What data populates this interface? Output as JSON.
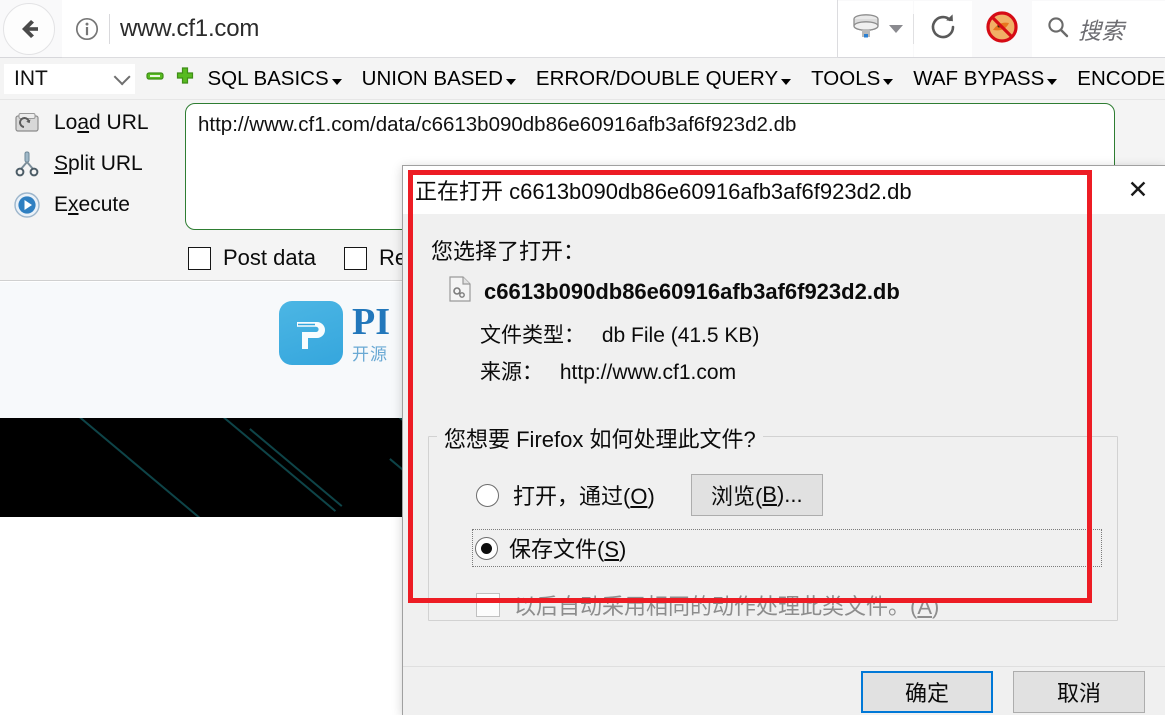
{
  "browser": {
    "back_icon": "back-arrow-icon",
    "identity_icon": "info-icon",
    "url": "www.cf1.com",
    "save_icon": "save-to-disk-icon",
    "save_caret_icon": "chevron-down-icon",
    "reload_icon": "reload-icon",
    "blocked_addon_icon": "no-firefox-icon",
    "search_icon": "search-icon",
    "search_placeholder": "搜索",
    "search_value": ""
  },
  "hackbar": {
    "type_select": {
      "value": "INT",
      "chevron_icon": "chevron-down-icon"
    },
    "minus_icon": "minus-icon",
    "plus_icon": "plus-icon",
    "menus": [
      {
        "label": "SQL BASICS",
        "has_arrow": true
      },
      {
        "label": "UNION BASED",
        "has_arrow": true
      },
      {
        "label": "ERROR/DOUBLE QUERY",
        "has_arrow": true
      },
      {
        "label": "TOOLS",
        "has_arrow": true
      },
      {
        "label": "WAF BYPASS",
        "has_arrow": true
      },
      {
        "label": "ENCODE",
        "has_arrow": false
      }
    ],
    "actions": [
      {
        "label_pre": "Lo",
        "label_key": "a",
        "label_post": "d URL",
        "icon": "load-url-icon"
      },
      {
        "label_pre": "",
        "label_key": "S",
        "label_post": "plit URL",
        "icon": "split-url-icon"
      },
      {
        "label_pre": "E",
        "label_key": "x",
        "label_post": "ecute",
        "icon": "execute-icon"
      }
    ],
    "url_value": "http://www.cf1.com/data/c6613b090db86e60916afb3af6f923d2.db",
    "checkboxes": [
      {
        "label": "Post data",
        "checked": false
      },
      {
        "label": "Re",
        "checked": false
      }
    ]
  },
  "page": {
    "logo_letter": "P",
    "logo_title": "PI",
    "logo_sub": "开源",
    "colors": {
      "logo_bg": "#35a6dd",
      "logo_text": "#2277bb",
      "hero_bg": "#000000"
    }
  },
  "dialog": {
    "title": "正在打开 c6613b090db86e60916afb3af6f923d2.db",
    "close_icon": "close-icon",
    "lead": "您选择了打开：",
    "file_icon": "db-file-icon",
    "file_name": "c6613b090db86e60916afb3af6f923d2.db",
    "type_label": "文件类型：",
    "type_value": "db File (41.5 KB)",
    "source_label": "来源：",
    "source_value": "http://www.cf1.com",
    "legend": "您想要 Firefox 如何处理此文件?",
    "option_open_pre": "打开，通过(",
    "option_open_key": "O",
    "option_open_post": ")",
    "option_open_selected": false,
    "browse_pre": "浏览(",
    "browse_key": "B",
    "browse_post": ")...",
    "option_save_pre": "保存文件(",
    "option_save_key": "S",
    "option_save_post": ")",
    "option_save_selected": true,
    "auto_pre": "以后自动采用相同的动作处理此类文件。(",
    "auto_key": "A",
    "auto_post": ")",
    "auto_checked": false,
    "auto_disabled": true,
    "ok_label": "确定",
    "cancel_label": "取消",
    "default_button_color": "#0078d7"
  },
  "annotation": {
    "color": "#ed1c24",
    "shape": "rectangle-highlight"
  }
}
